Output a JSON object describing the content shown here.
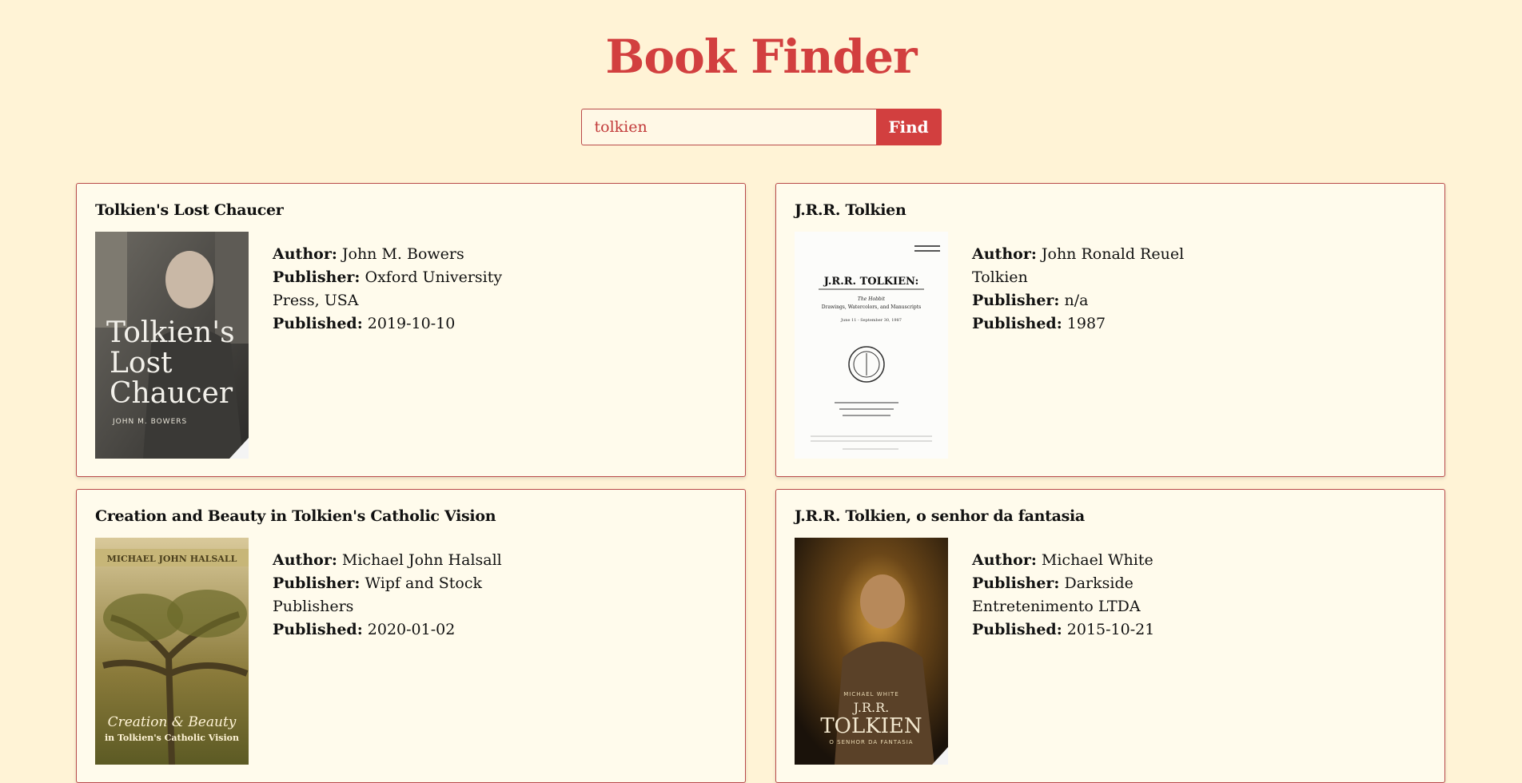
{
  "app": {
    "title": "Book Finder"
  },
  "search": {
    "value": "tolkien",
    "button_label": "Find"
  },
  "labels": {
    "author": "Author:",
    "publisher": "Publisher:",
    "published": "Published:"
  },
  "books": [
    {
      "title": "Tolkien's Lost Chaucer",
      "author": "John M. Bowers",
      "publisher": "Oxford University Press, USA",
      "published": "2019-10-10",
      "cover": {
        "l1": "Tolkien's",
        "l2": "Lost",
        "l3": "Chaucer",
        "l4": "JOHN M. BOWERS"
      }
    },
    {
      "title": "J.R.R. Tolkien",
      "author": "John Ronald Reuel Tolkien",
      "publisher": "n/a",
      "published": "1987",
      "cover": {
        "l1": "J.R.R. TOLKIEN:",
        "l2": "The Hobbit",
        "l3": "Drawings, Watercolors, and Manuscripts",
        "l4": "June 11 - September 30, 1987"
      }
    },
    {
      "title": "Creation and Beauty in Tolkien's Catholic Vision",
      "author": "Michael John Halsall",
      "publisher": "Wipf and Stock Publishers",
      "published": "2020-01-02",
      "cover": {
        "l1": "MICHAEL JOHN HALSALL",
        "l2": "Creation & Beauty",
        "l3": "in Tolkien's Catholic Vision"
      }
    },
    {
      "title": "J.R.R. Tolkien, o senhor da fantasia",
      "author": "Michael White",
      "publisher": "Darkside Entretenimento LTDA",
      "published": "2015-10-21",
      "cover": {
        "l1": "MICHAEL WHITE",
        "l2": "J.R.R.",
        "l3": "TOLKIEN",
        "l4": "O SENHOR DA FANTASIA"
      }
    }
  ],
  "colors": {
    "brand": "#d23f3f",
    "background": "#fff3d6",
    "card": "#fffbec"
  }
}
